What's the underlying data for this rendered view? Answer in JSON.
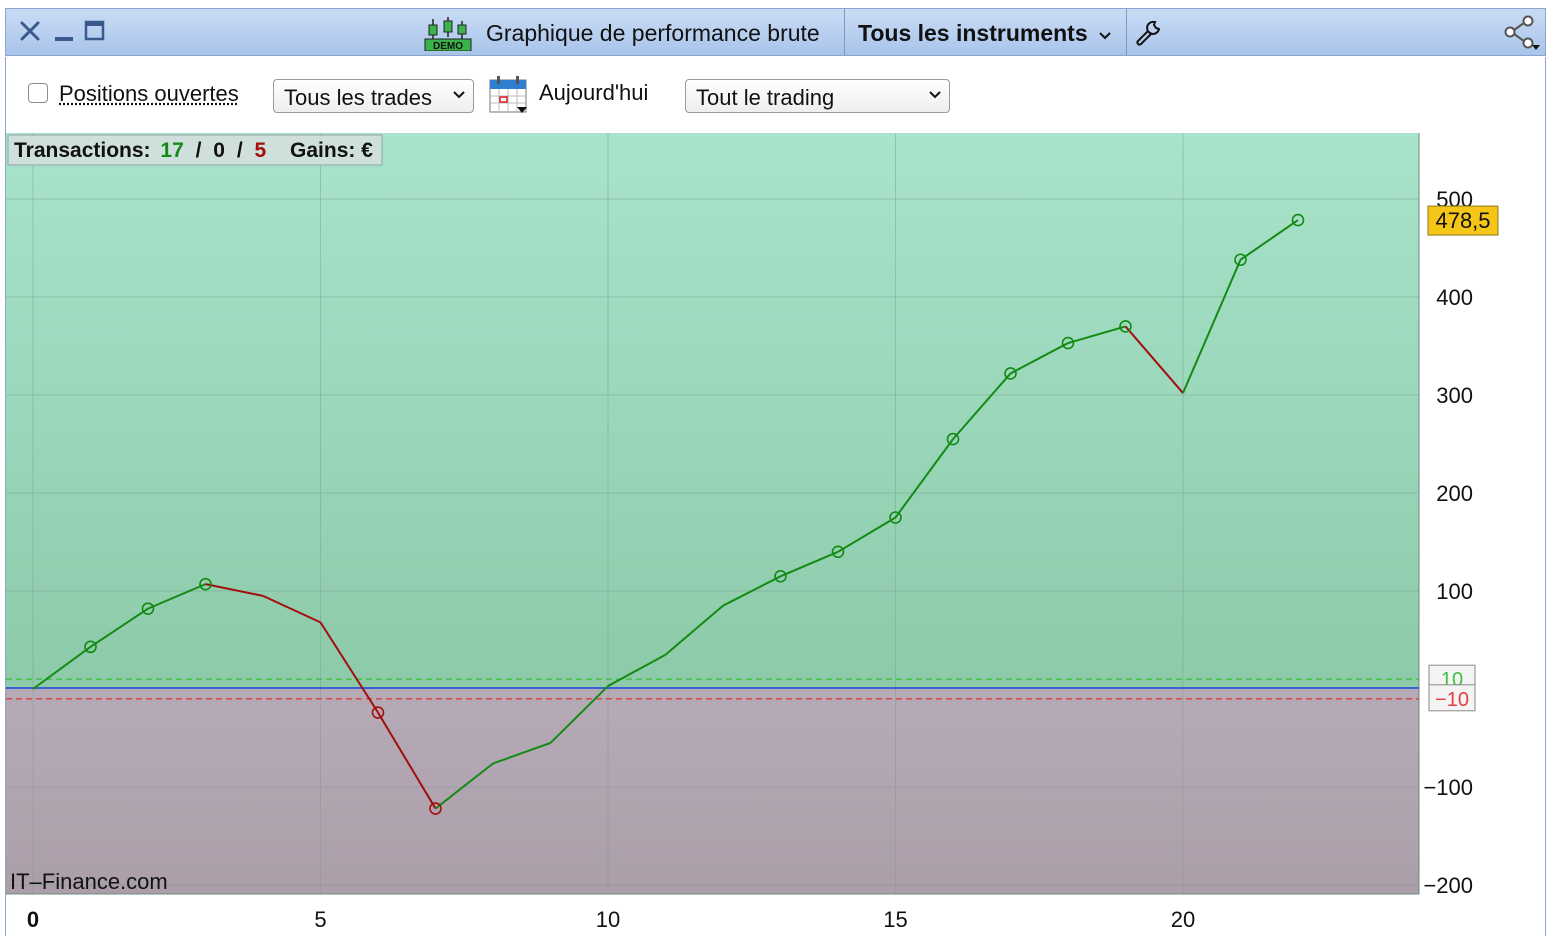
{
  "window": {
    "title": "Graphique de performance brute",
    "instrument_selector": "Tous les instruments",
    "demo_badge": "DEMO"
  },
  "toolbar": {
    "open_positions_label": "Positions ouvertes",
    "open_positions_checked": false,
    "trades_filter": "Tous les trades",
    "date_label": "Aujourd'hui",
    "trading_filter": "Tout le trading"
  },
  "stats": {
    "transactions_label": "Transactions:",
    "wins": "17",
    "sep1": "/",
    "neutral": "0",
    "sep2": "/",
    "losses": "5",
    "gains_label": "Gains: €"
  },
  "watermark": "IT–Finance.com",
  "colors": {
    "win": "#138a13",
    "loss": "#a30e0e",
    "price_tag": "#f5c518",
    "positive_zone": "#a5e0c8",
    "negative_zone": "#b2a6b1"
  },
  "chart_data": {
    "type": "line",
    "x": [
      0,
      1,
      2,
      3,
      4,
      5,
      6,
      7,
      8,
      9,
      10,
      11,
      12,
      13,
      14,
      15,
      16,
      17,
      18,
      19,
      20,
      21,
      22
    ],
    "values": [
      0,
      43,
      82,
      107,
      95,
      68,
      -24,
      -122,
      -76,
      -55,
      3,
      35,
      85,
      115,
      140,
      175,
      255,
      322,
      353,
      370,
      302,
      438,
      478.5
    ],
    "markers": [
      1,
      2,
      3,
      6,
      7,
      13,
      14,
      15,
      16,
      17,
      18,
      19,
      21,
      22
    ],
    "xlim": [
      0,
      24
    ],
    "ylim": [
      -210,
      565
    ],
    "x_ticks": [
      "0",
      "5",
      "10",
      "15",
      "20"
    ],
    "y_ticks": [
      "500",
      "400",
      "300",
      "200",
      "100",
      "−100",
      "−200"
    ],
    "thresholds": [
      {
        "value": 10,
        "label": "10",
        "color": "#3ec23e"
      },
      {
        "value": -10,
        "label": "−10",
        "color": "#e04040"
      }
    ],
    "last_value_label": "478,5",
    "grid": true
  }
}
